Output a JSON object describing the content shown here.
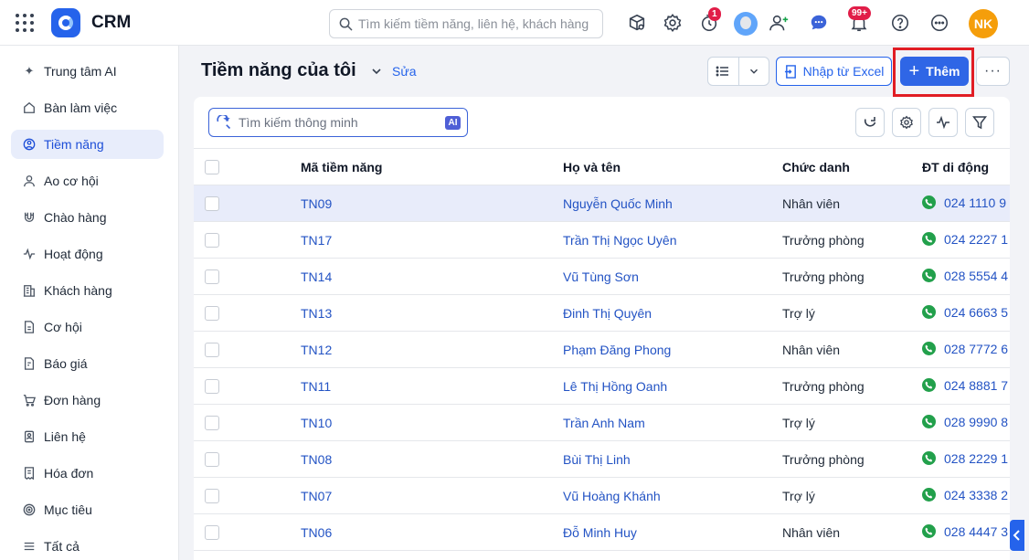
{
  "topbar": {
    "app_name": "CRM",
    "search_placeholder": "Tìm kiếm tiềm năng, liên hệ, khách hàng",
    "timer_badge": "1",
    "notification_badge": "99+",
    "user_initials": "NK"
  },
  "sidebar": {
    "items": [
      {
        "label": "Trung tâm AI",
        "icon": "sparkle-icon"
      },
      {
        "label": "Bàn làm việc",
        "icon": "home-icon"
      },
      {
        "label": "Tiềm năng",
        "icon": "target-icon",
        "active": true
      },
      {
        "label": "Ao cơ hội",
        "icon": "users-icon"
      },
      {
        "label": "Chào hàng",
        "icon": "magnet-icon"
      },
      {
        "label": "Hoạt động",
        "icon": "activity-icon"
      },
      {
        "label": "Khách hàng",
        "icon": "building-icon"
      },
      {
        "label": "Cơ hội",
        "icon": "document-icon"
      },
      {
        "label": "Báo giá",
        "icon": "quote-icon"
      },
      {
        "label": "Đơn hàng",
        "icon": "cart-icon"
      },
      {
        "label": "Liên hệ",
        "icon": "contact-icon"
      },
      {
        "label": "Hóa đơn",
        "icon": "invoice-icon"
      },
      {
        "label": "Mục tiêu",
        "icon": "goal-icon"
      },
      {
        "label": "Tất cả",
        "icon": "menu-icon"
      }
    ]
  },
  "header": {
    "title": "Tiềm năng của tôi",
    "edit_label": "Sửa",
    "import_label": "Nhập từ Excel",
    "add_label": "Thêm",
    "more_label": "···"
  },
  "toolbar": {
    "smart_search_placeholder": "Tìm kiếm thông minh",
    "ai_badge": "AI"
  },
  "table": {
    "columns": [
      "Mã tiềm năng",
      "Họ và tên",
      "Chức danh",
      "ĐT di động"
    ],
    "rows": [
      {
        "code": "TN09",
        "name": "Nguyễn Quốc Minh",
        "title": "Nhân viên",
        "phone": "024 1110 9"
      },
      {
        "code": "TN17",
        "name": "Trần Thị Ngọc Uyên",
        "title": "Trưởng phòng",
        "phone": "024 2227 1"
      },
      {
        "code": "TN14",
        "name": "Vũ Tùng Sơn",
        "title": "Trưởng phòng",
        "phone": "028 5554 4"
      },
      {
        "code": "TN13",
        "name": "Đinh Thị Quyên",
        "title": "Trợ lý",
        "phone": "024 6663 5"
      },
      {
        "code": "TN12",
        "name": "Phạm Đăng Phong",
        "title": "Nhân viên",
        "phone": "028 7772 6"
      },
      {
        "code": "TN11",
        "name": "Lê Thị Hồng Oanh",
        "title": "Trưởng phòng",
        "phone": "024 8881 7"
      },
      {
        "code": "TN10",
        "name": "Trần Anh Nam",
        "title": "Trợ lý",
        "phone": "028 9990 8"
      },
      {
        "code": "TN08",
        "name": "Bùi Thị Linh",
        "title": "Trưởng phòng",
        "phone": "028 2229 1"
      },
      {
        "code": "TN07",
        "name": "Vũ Hoàng Khánh",
        "title": "Trợ lý",
        "phone": "024 3338 2"
      },
      {
        "code": "TN06",
        "name": "Đỗ Minh Huy",
        "title": "Nhân viên",
        "phone": "028 4447 3"
      }
    ]
  },
  "colors": {
    "accent": "#2f66e6",
    "highlight": "#e11d24",
    "selected_row": "#e8ecfa",
    "phone_icon": "#22a04b"
  }
}
